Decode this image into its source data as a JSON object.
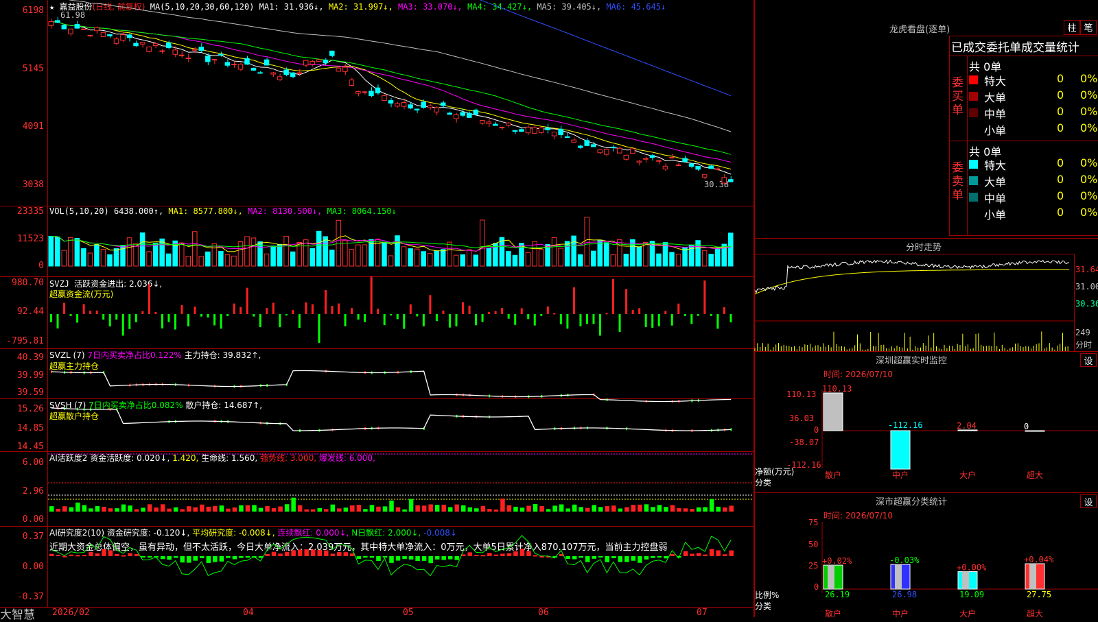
{
  "stock": {
    "name": "嘉益股份",
    "period": "(日线, 前复权)",
    "star": "★",
    "max_price": "61.98",
    "min_price": "30.38"
  },
  "main_header": {
    "ma_title": "MA(5,10,20,30,60,120)",
    "ma1": "MA1: 31.936↓,",
    "ma2": "MA2: 31.997↓,",
    "ma3": "MA3: 33.070↓,",
    "ma4": "MA4: 34.427↓,",
    "ma5": "MA5: 39.405↓,",
    "ma6": "MA6: 45.645↓"
  },
  "price_axis": [
    "6198",
    "5145",
    "4091",
    "3038"
  ],
  "vol_header": {
    "title": "VOL(5,10,20)",
    "value": "6438.000↑,",
    "ma1": "MA1: 8577.800↓,",
    "ma2": "MA2: 8130.500↓,",
    "ma3": "MA3: 8064.150↓"
  },
  "vol_axis": [
    "23335",
    "11523",
    "0"
  ],
  "svzj_header": {
    "title": "SVZJ",
    "text": "活跃资金进出: 2.036↓,",
    "sub": "超赢资金流(万元)"
  },
  "svzj_axis": [
    "980.70",
    "92.44",
    "-795.81"
  ],
  "svzl_header": {
    "title": "SVZL (7)",
    "ratio": "7日内买卖净占比0.122%",
    "hold": "主力持仓: 39.832↑,",
    "sub": "超赢主力持仓"
  },
  "svzl_axis": [
    "40.39",
    "39.99",
    "39.59"
  ],
  "svsh_header": {
    "title": "SVSH (7)",
    "ratio": "7日内买卖净占比0.082%",
    "hold": "散户持仓: 14.687↑,",
    "sub": "超赢散户持仓"
  },
  "svsh_axis": [
    "15.26",
    "14.85",
    "14.45"
  ],
  "ai_header": {
    "title": "AI活跃度2",
    "active": "资金活跃度: 0.020↓,",
    "v2": "1.420,",
    "life": "生命线: 1.560,",
    "strong": "强势线: 3.000,",
    "burst": "爆发线: 6.000,"
  },
  "ai_axis": [
    "6.00",
    "2.96",
    "0.00"
  ],
  "research_header": {
    "title": "AI研究度2(10)",
    "fund": "资金研究度: -0.120↓,",
    "avg": "平均研究度: -0.008↓,",
    "red": "连续飘红: 0.000↓,",
    "nred": "N日飘红: 2.000↓,",
    "last": "-0.008↓"
  },
  "research_text": "近期大资金总体偏空，虽有异动，但不太活跃，今日大单净流入：2.039万元，其中特大单净流入：0万元，大单5日累计净入870.107万元，当前主力控盘弱",
  "research_axis": [
    "0.37",
    "0.00",
    "-0.37"
  ],
  "dates": {
    "brand": "大智慧",
    "labels": [
      "2026/02",
      "04",
      "05",
      "06",
      "07"
    ]
  },
  "longhu": {
    "title": "龙虎看盘(逐单)",
    "btn1": "柱",
    "btn2": "笔",
    "sub": "已成交委托单成交量统计",
    "buy_label": "委买单",
    "sell_label": "委卖单",
    "buy_total": "共 0单",
    "sell_total": "共 0单",
    "buy_rows": [
      {
        "name": "特大",
        "val": "0",
        "pct": "0%",
        "color": "#ff0000"
      },
      {
        "name": "大单",
        "val": "0",
        "pct": "0%",
        "color": "#a00000"
      },
      {
        "name": "中单",
        "val": "0",
        "pct": "0%",
        "color": "#600000"
      },
      {
        "name": "小单",
        "val": "0",
        "pct": "0%",
        "color": ""
      }
    ],
    "sell_rows": [
      {
        "name": "特大",
        "val": "0",
        "pct": "0%",
        "color": "#00ffff"
      },
      {
        "name": "大单",
        "val": "0",
        "pct": "0%",
        "color": "#009999"
      },
      {
        "name": "中单",
        "val": "0",
        "pct": "0%",
        "color": "#006e6e"
      },
      {
        "name": "小单",
        "val": "0",
        "pct": "0%",
        "color": ""
      }
    ]
  },
  "intraday": {
    "title": "分时走势",
    "prices": [
      "31.64",
      "31.00",
      "30.36"
    ],
    "vol": "249",
    "vol_label": "分时"
  },
  "sz_monitor": {
    "title": "深圳超赢实时监控",
    "btn": "设",
    "time": "时间: 2026/07/10",
    "axis": [
      "110.13",
      "36.03",
      "0",
      "-38.07",
      "-112.16"
    ],
    "ylabel": "净额(万元)",
    "xlabel": "分类",
    "values": [
      "110.13",
      "-112.16",
      "2.04",
      "0"
    ],
    "categories": [
      "散户",
      "中户",
      "大户",
      "超大"
    ]
  },
  "sz_classify": {
    "title": "深市超赢分类统计",
    "btn": "设",
    "time": "时间: 2026/07/10",
    "axis": [
      "75",
      "50",
      "25",
      "0"
    ],
    "ylabel": "比例%",
    "xlabel": "分类",
    "changes": [
      "+0.02%",
      "-0.03%",
      "+0.00%",
      "+0.04%"
    ],
    "values": [
      "26.19",
      "26.98",
      "19.09",
      "27.75"
    ],
    "categories": [
      "散户",
      "中户",
      "大户",
      "超大"
    ]
  },
  "chart_data": [
    {
      "type": "candlestick",
      "title": "嘉益股份 (日线, 前复权)",
      "ylim": [
        30.38,
        61.98
      ],
      "tick_labels": [
        "6198",
        "5145",
        "4091",
        "3038"
      ],
      "x_labels": [
        "2026/02",
        "04",
        "05",
        "06",
        "07"
      ],
      "series": [
        {
          "name": "MA1",
          "last": 31.936
        },
        {
          "name": "MA2",
          "last": 31.997
        },
        {
          "name": "MA3",
          "last": 33.07
        },
        {
          "name": "MA4",
          "last": 34.427
        },
        {
          "name": "MA5",
          "last": 39.405
        },
        {
          "name": "MA6",
          "last": 45.645
        }
      ]
    },
    {
      "type": "bar",
      "title": "VOL(5,10,20)",
      "ylim": [
        0,
        23335
      ],
      "last": 6438.0,
      "series": [
        {
          "name": "MA1",
          "last": 8577.8
        },
        {
          "name": "MA2",
          "last": 8130.5
        },
        {
          "name": "MA3",
          "last": 8064.15
        }
      ]
    },
    {
      "type": "bar",
      "title": "SZ monitor",
      "categories": [
        "散户",
        "中户",
        "大户",
        "超大"
      ],
      "values": [
        110.13,
        -112.16,
        2.04,
        0
      ],
      "ylim": [
        -112.16,
        110.13
      ]
    },
    {
      "type": "bar",
      "title": "SZ classify",
      "categories": [
        "散户",
        "中户",
        "大户",
        "超大"
      ],
      "values": [
        26.19,
        26.98,
        19.09,
        27.75
      ],
      "ylim": [
        0,
        75
      ]
    }
  ]
}
